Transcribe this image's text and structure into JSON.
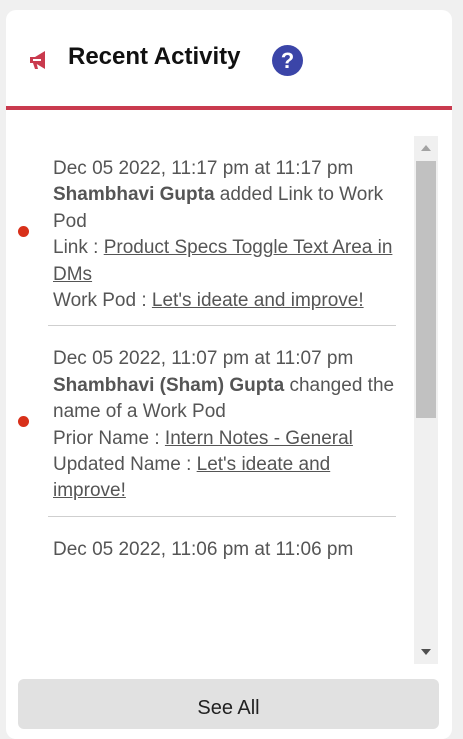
{
  "header": {
    "title": "Recent Activity",
    "help_symbol": "?",
    "icon": "megaphone-icon",
    "accent_color": "#c93a4e"
  },
  "activities": [
    {
      "timestamp": "Dec 05 2022, 11:17 pm at 11:17 pm",
      "actor": "Shambhavi Gupta",
      "action": " added Link to Work Pod",
      "detail1_label": "Link : ",
      "detail1_value": "Product Specs Toggle Text Area in DMs",
      "detail2_label": "Work Pod : ",
      "detail2_value": "Let's ideate and improve!"
    },
    {
      "timestamp": "Dec 05 2022, 11:07 pm at 11:07 pm",
      "actor": "Shambhavi (Sham) Gupta",
      "action": " changed the name of a Work Pod",
      "detail1_label": "Prior Name : ",
      "detail1_value": "Intern Notes - General",
      "detail2_label": "Updated Name : ",
      "detail2_value": "Let's ideate and improve!"
    },
    {
      "timestamp": "Dec 05 2022, 11:06 pm at 11:06 pm"
    }
  ],
  "footer": {
    "see_all_label": "See All"
  }
}
